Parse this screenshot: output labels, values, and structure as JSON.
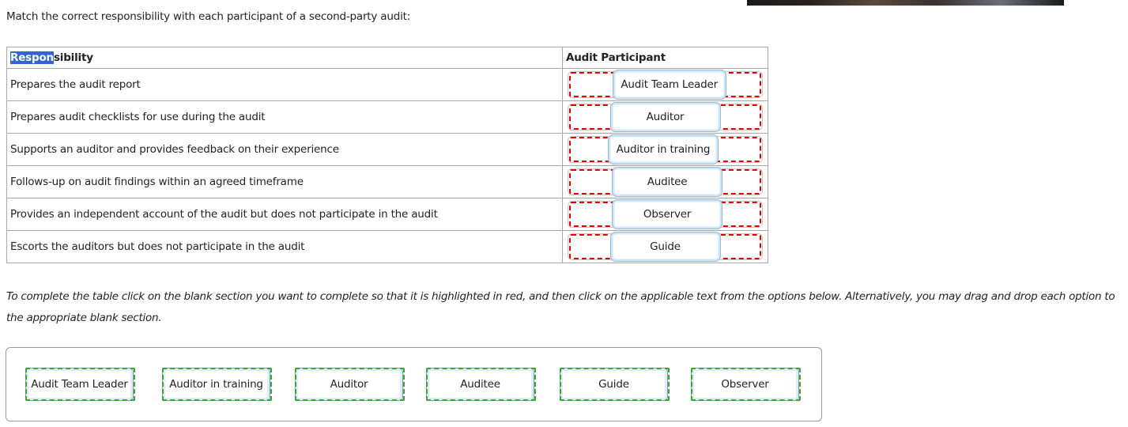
{
  "instruction": "Match the correct responsibility with each participant of a second-party audit:",
  "table": {
    "headers": {
      "responsibility_highlighted": "Respon",
      "responsibility_rest": "sibility",
      "participant": "Audit Participant"
    },
    "rows": [
      {
        "responsibility": "Prepares the audit report",
        "answer": "Audit Team Leader"
      },
      {
        "responsibility": "Prepares audit checklists for use during the audit",
        "answer": "Auditor"
      },
      {
        "responsibility": "Supports an auditor and provides feedback on their experience",
        "answer": "Auditor in training"
      },
      {
        "responsibility": "Follows-up on audit findings within an agreed timeframe",
        "answer": "Auditee"
      },
      {
        "responsibility": "Provides an independent account of the audit but does not participate in the audit",
        "answer": "Observer"
      },
      {
        "responsibility": "Escorts the auditors but does not participate in the audit",
        "answer": "Guide"
      }
    ]
  },
  "note": "To complete the table click on the blank section you want to complete so that it is highlighted in red, and then click on the applicable text from the options below. Alternatively, you may drag and drop each option to the appropriate blank section.",
  "options": [
    "Audit Team Leader",
    "Auditor in training",
    "Auditor",
    "Auditee",
    "Guide",
    "Observer"
  ],
  "colors": {
    "selection_highlight": "#3366cc",
    "slot_dashed": "#e00000",
    "option_dashed": "#3aa63a"
  }
}
